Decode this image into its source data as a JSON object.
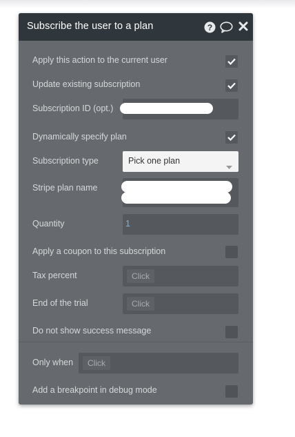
{
  "dialog": {
    "title": "Subscribe the user to a plan",
    "icons": {
      "help": "help-icon",
      "comment": "comment-icon",
      "close": "close-icon"
    }
  },
  "rows": {
    "apply_current_user": {
      "label": "Apply this action to the current user",
      "checked": true
    },
    "update_existing": {
      "label": "Update existing subscription",
      "checked": true
    },
    "subscription_id": {
      "label": "Subscription ID (opt.)",
      "value_redacted": true
    },
    "dynamic_plan": {
      "label": "Dynamically specify plan",
      "checked": true
    },
    "subscription_type": {
      "label": "Subscription type",
      "selected": "Pick one plan"
    },
    "stripe_plan_name": {
      "label": "Stripe plan name",
      "value_redacted": true
    },
    "quantity": {
      "label": "Quantity",
      "value": "1"
    },
    "apply_coupon": {
      "label": "Apply a coupon to this subscription",
      "checked": false
    },
    "tax_percent": {
      "label": "Tax percent",
      "placeholder": "Click"
    },
    "end_of_trial": {
      "label": "End of the trial",
      "placeholder": "Click"
    },
    "no_success_message": {
      "label": "Do not show success message",
      "checked": false
    },
    "only_when": {
      "label": "Only when",
      "placeholder": "Click"
    },
    "breakpoint": {
      "label": "Add a breakpoint in debug mode",
      "checked": false
    }
  },
  "colors": {
    "panel": "#666a6e",
    "header": "#30373c",
    "field": "#55595d",
    "value_text": "#7fb0e0"
  }
}
